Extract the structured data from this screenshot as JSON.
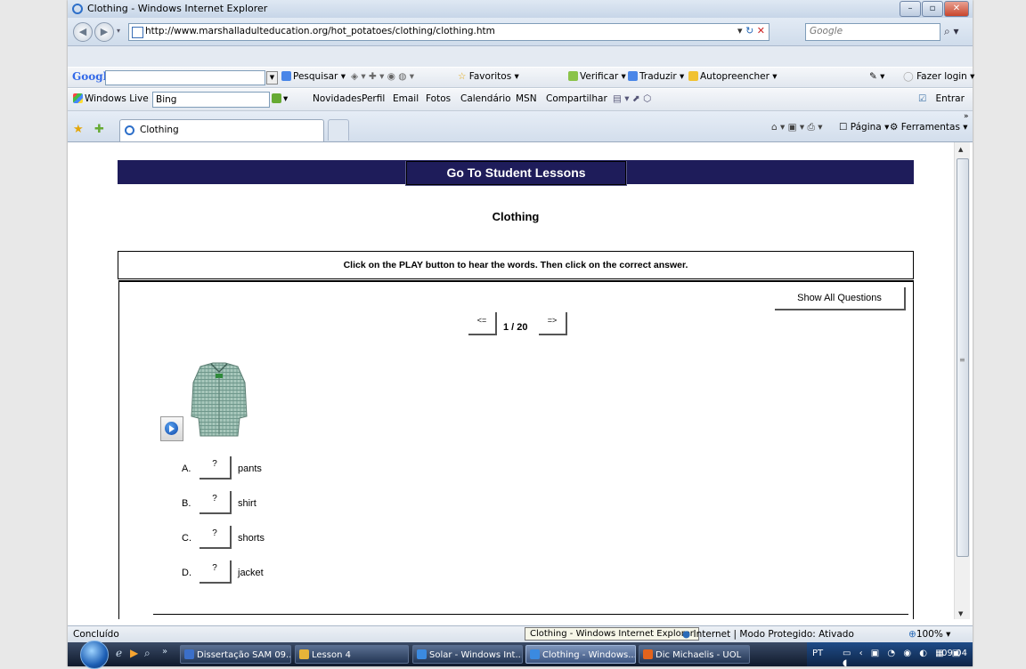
{
  "window": {
    "title": "Clothing - Windows Internet Explorer"
  },
  "address_bar": {
    "url": "http://www.marshalladulteducation.org/hot_potatoes/clothing/clothing.htm",
    "search_placeholder": "Google"
  },
  "google_toolbar": {
    "logo": "Google",
    "items": [
      "Pesquisar",
      "Favoritos",
      "Verificar",
      "Traduzir",
      "Autopreencher",
      "Fazer login"
    ]
  },
  "windows_live_bar": {
    "brand": "Windows Live",
    "search_value": "Bing",
    "links": [
      "Novidades",
      "Perfil",
      "Email",
      "Fotos",
      "Calendário",
      "MSN",
      "Compartilhar"
    ],
    "entrar": "Entrar"
  },
  "tabs": {
    "active_tab": "Clothing",
    "commands": [
      "Página",
      "Ferramentas"
    ]
  },
  "page": {
    "header_link": "Go To Student Lessons",
    "title": "Clothing",
    "instruction": "Click on the PLAY button to hear the words. Then click on the correct answer.",
    "show_all": "Show All Questions",
    "prev": "<=",
    "next": "=>",
    "counter": "1 / 20",
    "options": [
      {
        "letter": "A.",
        "button": "?",
        "word": "pants"
      },
      {
        "letter": "B.",
        "button": "?",
        "word": "shirt"
      },
      {
        "letter": "C.",
        "button": "?",
        "word": "shorts"
      },
      {
        "letter": "D.",
        "button": "?",
        "word": "jacket"
      }
    ]
  },
  "status_bar": {
    "text": "Concluído",
    "tooltip": "Clothing - Windows Internet Explorer",
    "zone": "Internet | Modo Protegido: Ativado",
    "zoom": "100%"
  },
  "taskbar": {
    "buttons": [
      {
        "label": "Dissertação SAM 09....",
        "active": false
      },
      {
        "label": "Lesson 4",
        "active": false
      },
      {
        "label": "Solar - Windows Int...",
        "active": false
      },
      {
        "label": "Clothing - Windows...",
        "active": true
      },
      {
        "label": "Dic Michaelis - UOL",
        "active": false
      }
    ],
    "language": "PT",
    "clock": "09:04"
  },
  "colors": {
    "header_navy": "#1e1c5a",
    "title_bar": "#c7d6e8",
    "taskbar": "#0f1a2c"
  }
}
